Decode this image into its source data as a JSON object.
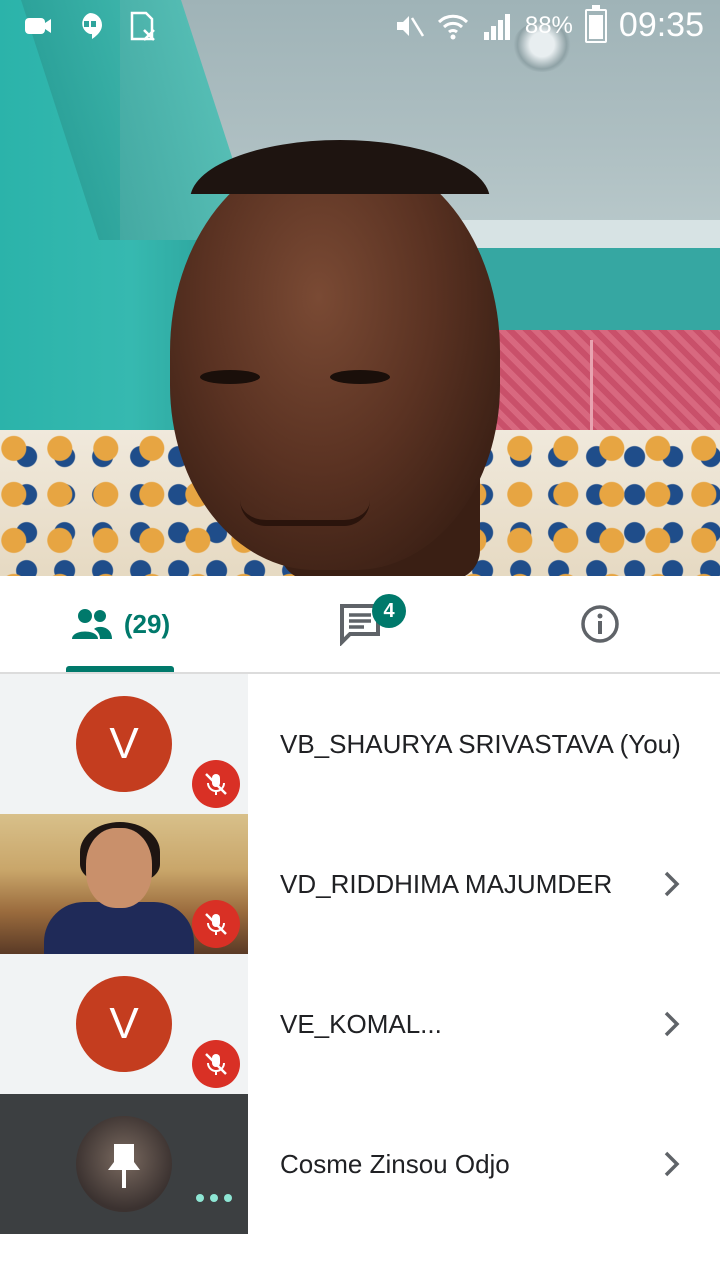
{
  "status_bar": {
    "battery_text": "88%",
    "time": "09:35",
    "icons": [
      "meet-notification-icon",
      "hangouts-icon",
      "sim-off-icon",
      "mute-icon",
      "wifi-icon",
      "signal-icon",
      "battery-icon"
    ]
  },
  "tabs": {
    "people_count": "(29)",
    "chat_badge": "4",
    "active": "people"
  },
  "participants": [
    {
      "name": "VB_SHAURYA SRIVASTAVA (You)",
      "avatar_letter": "V",
      "muted": true,
      "thumbnail": "avatar"
    },
    {
      "name": "VD_RIDDHIMA MAJUMDER",
      "muted": true,
      "thumbnail": "camera"
    },
    {
      "name": "VE_KOMAL...",
      "avatar_letter": "V",
      "muted": true,
      "thumbnail": "avatar"
    },
    {
      "name": "Cosme Zinsou Odjo",
      "muted": false,
      "thumbnail": "speaking"
    }
  ],
  "colors": {
    "accent": "#00796b",
    "mute_red": "#d93025",
    "avatar_red": "#c43d1f"
  }
}
